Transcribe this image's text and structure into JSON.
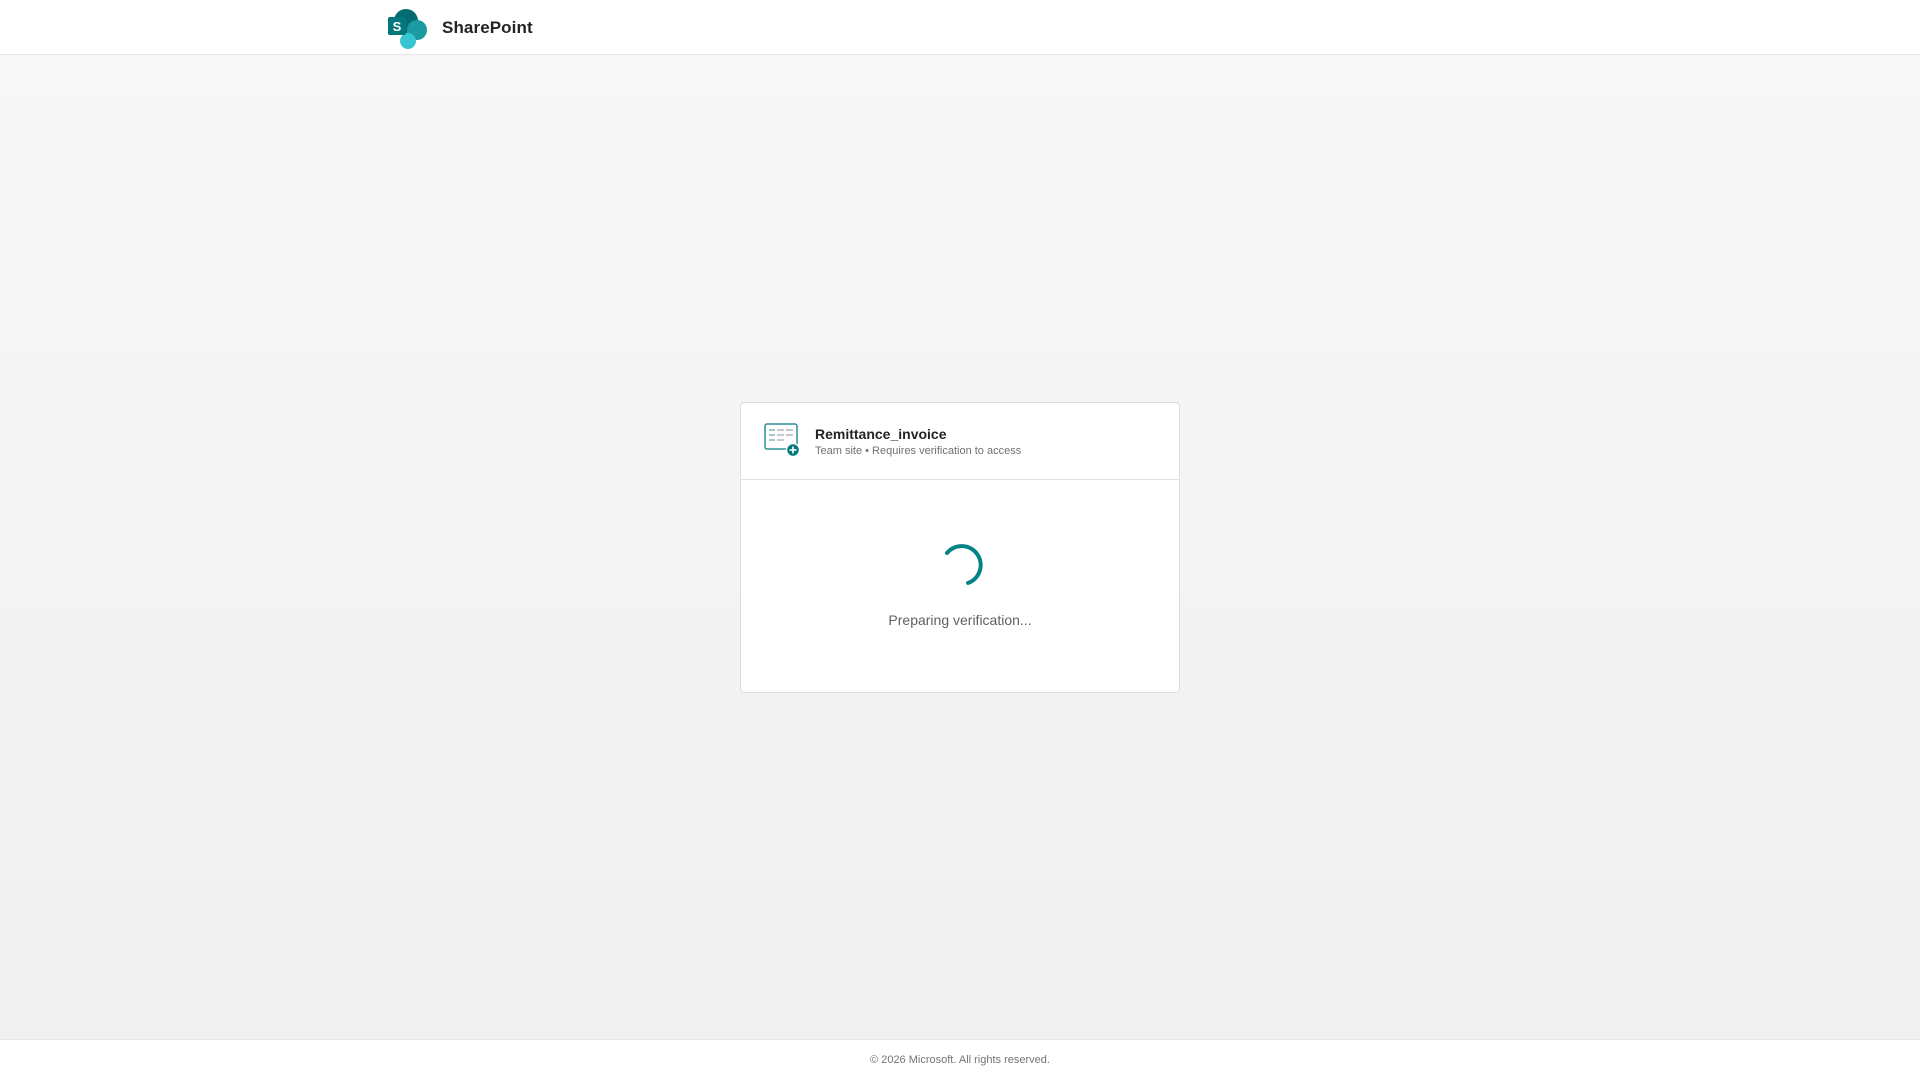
{
  "app": {
    "name": "SharePoint",
    "logo_icon": "sharepoint-logo-icon"
  },
  "site": {
    "title": "Remittance_invoice",
    "subtitle": "Team site • Requires verification to access",
    "icon": "team-site-icon"
  },
  "status": {
    "message": "Preparing verification...",
    "icon": "loading-spinner-icon"
  },
  "footer": {
    "copyright": "© 2026 Microsoft. All rights reserved."
  },
  "colors": {
    "accent": "#038387",
    "brand_dark": "#036c70",
    "brand_light": "#37c6d0"
  }
}
